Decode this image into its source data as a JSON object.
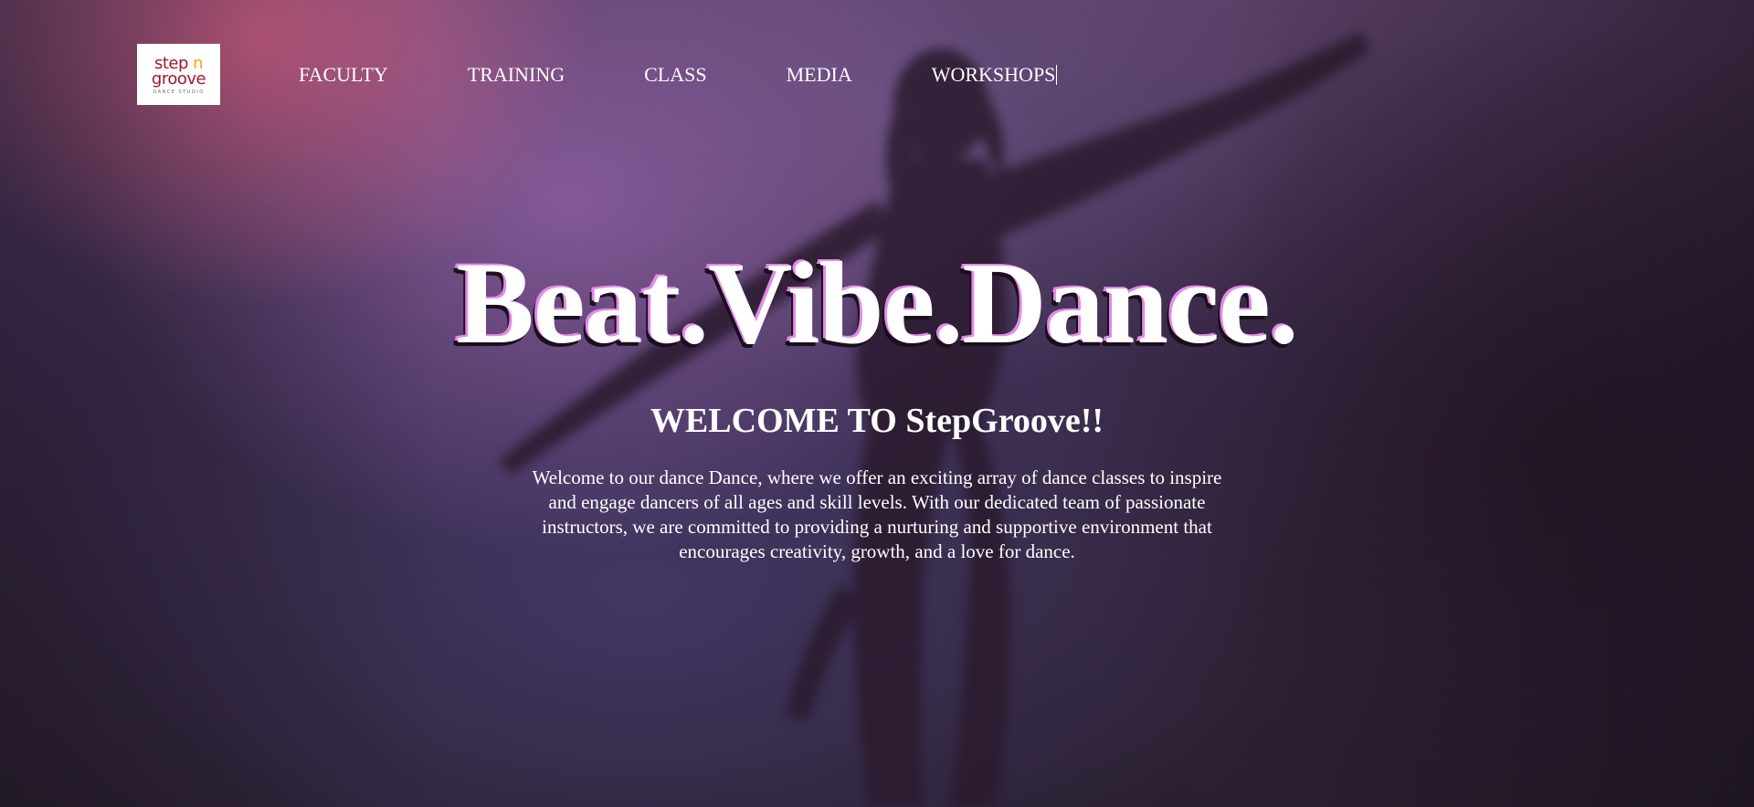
{
  "logo": {
    "line1_a": "step",
    "line1_b": "n",
    "line2": "groove",
    "tagline": "DANCE STUDIO"
  },
  "nav": {
    "items": [
      {
        "label": "FACULTY"
      },
      {
        "label": "TRAINING"
      },
      {
        "label": "CLASS"
      },
      {
        "label": "MEDIA"
      },
      {
        "label": "WORKSHOPS"
      }
    ]
  },
  "hero": {
    "headline": "Beat.Vibe.Dance.",
    "welcome": "WELCOME TO StepGroove!!",
    "intro": "Welcome to our dance Dance, where we offer an exciting array of dance classes to inspire and engage dancers of all ages and skill levels. With our dedicated team of passionate instructors, we are committed to providing a nurturing and supportive environment that encourages creativity, growth, and a love for dance."
  },
  "colors": {
    "logo_red": "#a3172b",
    "logo_yellow": "#f2a51a",
    "headline_glow": "#e48ae8",
    "text": "#ffffff"
  }
}
